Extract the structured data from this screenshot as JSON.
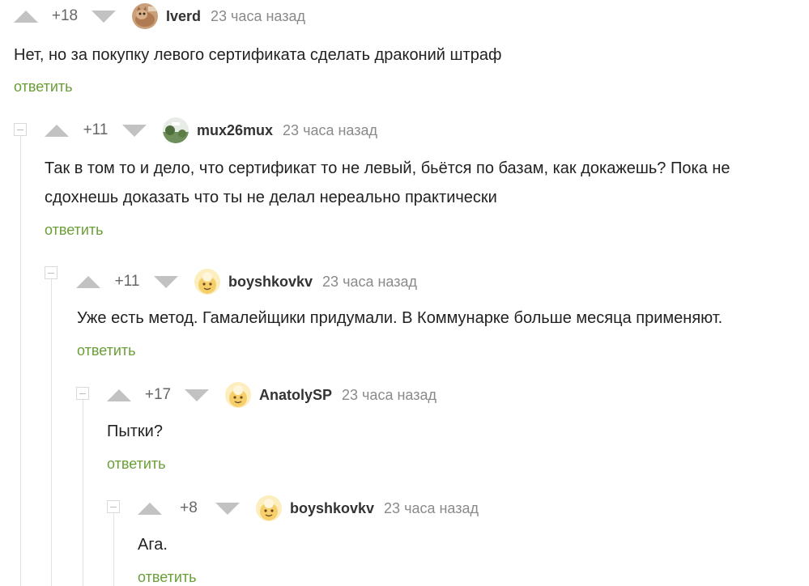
{
  "comments": [
    {
      "rating": "+18",
      "author": "Iverd",
      "time": "23 часа назад",
      "lines": [
        "Нет, но за покупку левого сертификата сделать драконий штраф"
      ],
      "reply": "ответить",
      "avatar": "cat-photo-avatar"
    },
    {
      "rating": "+11",
      "author": "mux26mux",
      "time": "23 часа назад",
      "lines": [
        "Так в том то и дело, что сертификат то не левый, бьётся по базам, как докажешь? Пока не",
        "сдохнешь доказать что ты не делал нереально практически"
      ],
      "reply": "ответить",
      "avatar": "landscape-photo-avatar"
    },
    {
      "rating": "+11",
      "author": "boyshkovkv",
      "time": "23 часа назад",
      "lines": [
        "Уже есть метод. Гамалейщики придумали. В Коммунарке больше месяца применяют."
      ],
      "reply": "ответить",
      "avatar": "default-face-avatar"
    },
    {
      "rating": "+17",
      "author": "AnatolySP",
      "time": "23 часа назад",
      "lines": [
        "Пытки?"
      ],
      "reply": "ответить",
      "avatar": "default-face-avatar"
    },
    {
      "rating": "+8",
      "author": "boyshkovkv",
      "time": "23 часа назад",
      "lines": [
        "Ага."
      ],
      "reply": "ответить",
      "avatar": "default-face-avatar"
    }
  ],
  "colors": {
    "reply_link": "#6a9e37",
    "vote_arrow": "#c2c2c2",
    "muted_text": "#8a8a8a",
    "thread_line": "#e2e2e2"
  }
}
